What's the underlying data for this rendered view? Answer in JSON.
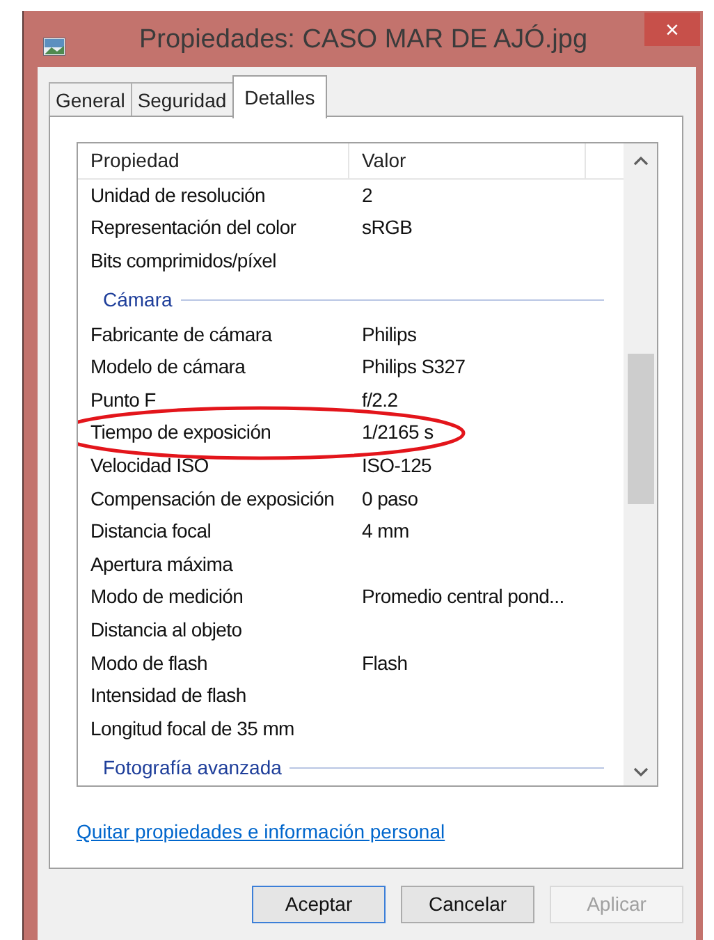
{
  "window": {
    "title": "Propiedades: CASO MAR DE AJÓ.jpg",
    "close": "×"
  },
  "tabs": [
    {
      "label": "General",
      "selected": false
    },
    {
      "label": "Seguridad",
      "selected": false
    },
    {
      "label": "Detalles",
      "selected": true
    }
  ],
  "table": {
    "columns": [
      "Propiedad",
      "Valor"
    ],
    "rows": [
      {
        "kind": "row",
        "property": "Unidad de resolución",
        "value": "2"
      },
      {
        "kind": "row",
        "property": "Representación del color",
        "value": "sRGB"
      },
      {
        "kind": "row",
        "property": "Bits comprimidos/píxel",
        "value": ""
      },
      {
        "kind": "section",
        "property": "Cámara"
      },
      {
        "kind": "row",
        "property": "Fabricante de cámara",
        "value": "Philips"
      },
      {
        "kind": "row",
        "property": "Modelo de cámara",
        "value": "Philips S327"
      },
      {
        "kind": "row",
        "property": "Punto F",
        "value": "f/2.2"
      },
      {
        "kind": "row",
        "property": "Tiempo de exposición",
        "value": "1/2165 s",
        "circled": true
      },
      {
        "kind": "row",
        "property": "Velocidad ISO",
        "value": "ISO-125"
      },
      {
        "kind": "row",
        "property": "Compensación de exposición",
        "value": "0 paso"
      },
      {
        "kind": "row",
        "property": "Distancia focal",
        "value": "4 mm"
      },
      {
        "kind": "row",
        "property": "Apertura máxima",
        "value": ""
      },
      {
        "kind": "row",
        "property": "Modo de medición",
        "value": "Promedio central pond..."
      },
      {
        "kind": "row",
        "property": "Distancia al objeto",
        "value": ""
      },
      {
        "kind": "row",
        "property": "Modo de flash",
        "value": "Flash"
      },
      {
        "kind": "row",
        "property": "Intensidad de flash",
        "value": ""
      },
      {
        "kind": "row",
        "property": "Longitud focal de 35 mm",
        "value": ""
      },
      {
        "kind": "section",
        "property": "Fotografía avanzada"
      }
    ]
  },
  "link": "Quitar propiedades e información personal",
  "buttons": [
    {
      "label": "Aceptar",
      "default": true,
      "disabled": false
    },
    {
      "label": "Cancelar",
      "default": false,
      "disabled": false
    },
    {
      "label": "Aplicar",
      "default": false,
      "disabled": true
    }
  ]
}
